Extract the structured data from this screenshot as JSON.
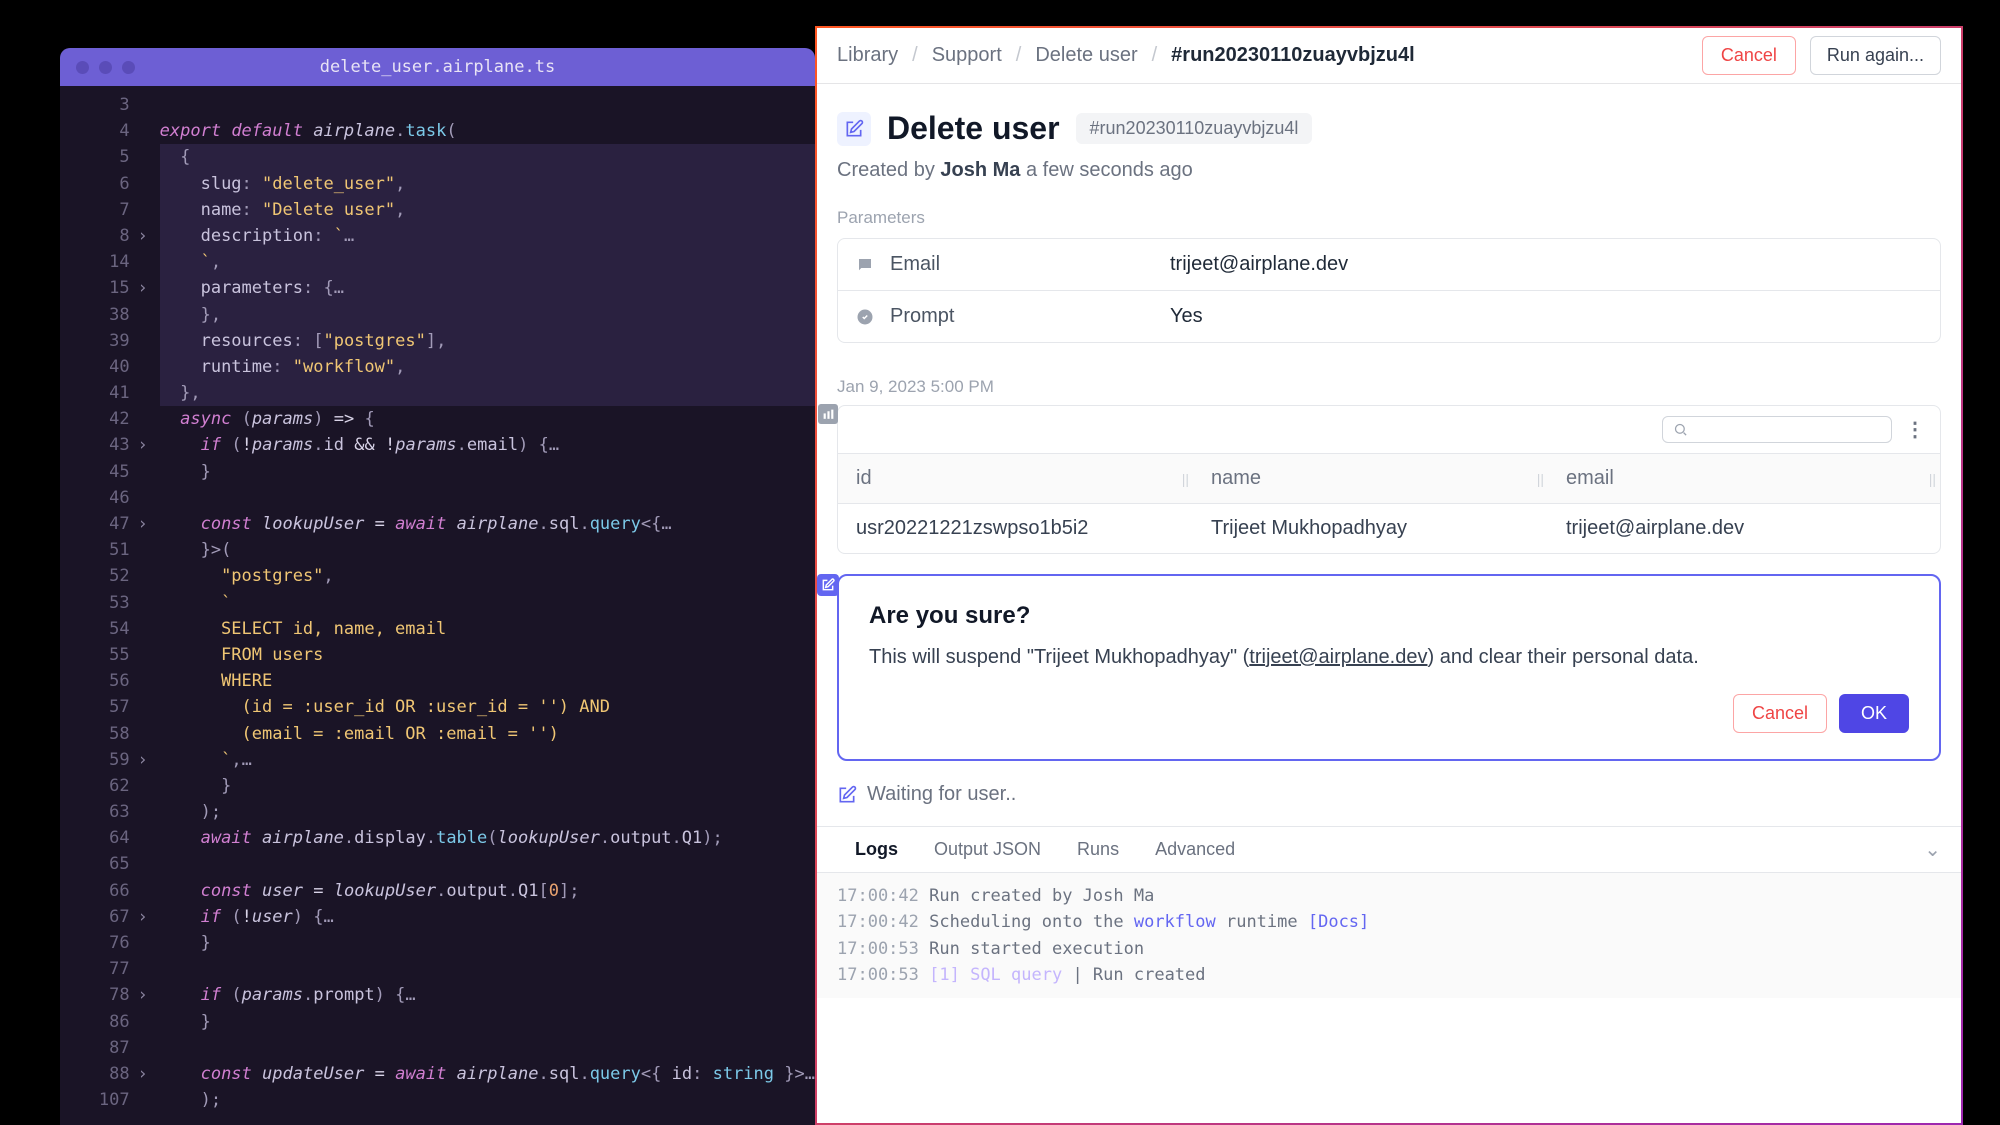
{
  "editor": {
    "title": "delete_user.airplane.ts",
    "lines": [
      {
        "n": 3,
        "fold": false,
        "code": ""
      },
      {
        "n": 4,
        "fold": false,
        "code": "<span class='c-kw'>export</span> <span class='c-kw'>default</span> <span class='c-var'>airplane</span><span class='c-punc'>.</span><span class='c-fn'>task</span><span class='c-punc'>(</span>"
      },
      {
        "n": 5,
        "fold": false,
        "hl": true,
        "code": "  <span class='c-punc'>{</span>"
      },
      {
        "n": 6,
        "fold": false,
        "hl": true,
        "code": "    <span class='c-prop'>slug</span><span class='c-punc'>:</span> <span class='c-str'>\"delete_user\"</span><span class='c-punc'>,</span>"
      },
      {
        "n": 7,
        "fold": false,
        "hl": true,
        "code": "    <span class='c-prop'>name</span><span class='c-punc'>:</span> <span class='c-str'>\"Delete user\"</span><span class='c-punc'>,</span>"
      },
      {
        "n": 8,
        "fold": true,
        "hl": true,
        "code": "    <span class='c-prop'>description</span><span class='c-punc'>:</span> <span class='c-str'>`</span><span class='c-punc'>…</span>"
      },
      {
        "n": 14,
        "fold": false,
        "hl": true,
        "code": "    <span class='c-str'>`</span><span class='c-punc'>,</span>"
      },
      {
        "n": 15,
        "fold": true,
        "hl": true,
        "code": "    <span class='c-prop'>parameters</span><span class='c-punc'>:</span> <span class='c-punc'>{</span><span class='c-punc'>…</span>"
      },
      {
        "n": 38,
        "fold": false,
        "hl": true,
        "code": "    <span class='c-punc'>},</span>"
      },
      {
        "n": 39,
        "fold": false,
        "hl": true,
        "code": "    <span class='c-prop'>resources</span><span class='c-punc'>:</span> <span class='c-punc'>[</span><span class='c-str'>\"postgres\"</span><span class='c-punc'>],</span>"
      },
      {
        "n": 40,
        "fold": false,
        "hl": true,
        "code": "    <span class='c-prop'>runtime</span><span class='c-punc'>:</span> <span class='c-str'>\"workflow\"</span><span class='c-punc'>,</span>"
      },
      {
        "n": 41,
        "fold": false,
        "hl": true,
        "code": "  <span class='c-punc'>},</span>"
      },
      {
        "n": 42,
        "fold": false,
        "code": "  <span class='c-kw'>async</span> <span class='c-punc'>(</span><span class='c-var'>params</span><span class='c-punc'>)</span> <span class='c-op'>=></span> <span class='c-punc'>{</span>"
      },
      {
        "n": 43,
        "fold": true,
        "code": "    <span class='c-kw'>if</span> <span class='c-punc'>(</span><span class='c-op'>!</span><span class='c-var'>params</span><span class='c-punc'>.</span><span class='c-prop'>id</span> <span class='c-op'>&&</span> <span class='c-op'>!</span><span class='c-var'>params</span><span class='c-punc'>.</span><span class='c-prop'>email</span><span class='c-punc'>)</span> <span class='c-punc'>{</span><span class='c-punc'>…</span>"
      },
      {
        "n": 45,
        "fold": false,
        "code": "    <span class='c-punc'>}</span>"
      },
      {
        "n": 46,
        "fold": false,
        "code": ""
      },
      {
        "n": 47,
        "fold": true,
        "code": "    <span class='c-kw'>const</span> <span class='c-var'>lookupUser</span> <span class='c-op'>=</span> <span class='c-kw'>await</span> <span class='c-var'>airplane</span><span class='c-punc'>.</span><span class='c-prop'>sql</span><span class='c-punc'>.</span><span class='c-fn'>query</span><span class='c-punc'>&lt;{</span><span class='c-punc'>…</span>"
      },
      {
        "n": 51,
        "fold": false,
        "code": "    <span class='c-punc'>}&gt;(</span>"
      },
      {
        "n": 52,
        "fold": false,
        "code": "      <span class='c-str'>\"postgres\"</span><span class='c-punc'>,</span>"
      },
      {
        "n": 53,
        "fold": false,
        "code": "      <span class='c-str'>`</span>"
      },
      {
        "n": 54,
        "fold": false,
        "code": "<span class='c-str'>      SELECT id, name, email</span>"
      },
      {
        "n": 55,
        "fold": false,
        "code": "<span class='c-str'>      FROM users</span>"
      },
      {
        "n": 56,
        "fold": false,
        "code": "<span class='c-str'>      WHERE</span>"
      },
      {
        "n": 57,
        "fold": false,
        "code": "<span class='c-str'>        (id = :user_id OR :user_id = '') AND</span>"
      },
      {
        "n": 58,
        "fold": false,
        "code": "<span class='c-str'>        (email = :email OR :email = '')</span>"
      },
      {
        "n": 59,
        "fold": true,
        "code": "      <span class='c-str'>`</span><span class='c-punc'>,</span><span class='c-punc'>…</span>"
      },
      {
        "n": 62,
        "fold": false,
        "code": "      <span class='c-punc'>}</span>"
      },
      {
        "n": 63,
        "fold": false,
        "code": "    <span class='c-punc'>);</span>"
      },
      {
        "n": 64,
        "fold": false,
        "code": "    <span class='c-kw'>await</span> <span class='c-var'>airplane</span><span class='c-punc'>.</span><span class='c-prop'>display</span><span class='c-punc'>.</span><span class='c-fn'>table</span><span class='c-punc'>(</span><span class='c-var'>lookupUser</span><span class='c-punc'>.</span><span class='c-prop'>output</span><span class='c-punc'>.</span><span class='c-prop'>Q1</span><span class='c-punc'>);</span>"
      },
      {
        "n": 65,
        "fold": false,
        "code": ""
      },
      {
        "n": 66,
        "fold": false,
        "code": "    <span class='c-kw'>const</span> <span class='c-var'>user</span> <span class='c-op'>=</span> <span class='c-var'>lookupUser</span><span class='c-punc'>.</span><span class='c-prop'>output</span><span class='c-punc'>.</span><span class='c-prop'>Q1</span><span class='c-punc'>[</span><span class='c-num'>0</span><span class='c-punc'>];</span>"
      },
      {
        "n": 67,
        "fold": true,
        "code": "    <span class='c-kw'>if</span> <span class='c-punc'>(</span><span class='c-op'>!</span><span class='c-var'>user</span><span class='c-punc'>)</span> <span class='c-punc'>{</span><span class='c-punc'>…</span>"
      },
      {
        "n": 76,
        "fold": false,
        "code": "    <span class='c-punc'>}</span>"
      },
      {
        "n": 77,
        "fold": false,
        "code": ""
      },
      {
        "n": 78,
        "fold": true,
        "code": "    <span class='c-kw'>if</span> <span class='c-punc'>(</span><span class='c-var'>params</span><span class='c-punc'>.</span><span class='c-prop'>prompt</span><span class='c-punc'>)</span> <span class='c-punc'>{</span><span class='c-punc'>…</span>"
      },
      {
        "n": 86,
        "fold": false,
        "code": "    <span class='c-punc'>}</span>"
      },
      {
        "n": 87,
        "fold": false,
        "code": ""
      },
      {
        "n": 88,
        "fold": true,
        "code": "    <span class='c-kw'>const</span> <span class='c-var'>updateUser</span> <span class='c-op'>=</span> <span class='c-kw'>await</span> <span class='c-var'>airplane</span><span class='c-punc'>.</span><span class='c-prop'>sql</span><span class='c-punc'>.</span><span class='c-fn'>query</span><span class='c-punc'>&lt;{</span> <span class='c-prop'>id</span><span class='c-punc'>:</span> <span class='c-type'>string</span> <span class='c-punc'>}&gt;</span><span class='c-punc'>…</span>"
      },
      {
        "n": 107,
        "fold": false,
        "code": "    <span class='c-punc'>);</span>"
      }
    ]
  },
  "breadcrumbs": [
    "Library",
    "Support",
    "Delete user"
  ],
  "run_id": "#run20230110zuayvbjzu4l",
  "header": {
    "cancel": "Cancel",
    "run_again": "Run again..."
  },
  "title": "Delete user",
  "created_by_prefix": "Created by ",
  "created_by_name": "Josh Ma",
  "created_by_suffix": " a few seconds ago",
  "params_label": "Parameters",
  "params": [
    {
      "icon": "chat",
      "key": "Email",
      "val": "trijeet@airplane.dev"
    },
    {
      "icon": "check",
      "key": "Prompt",
      "val": "Yes"
    }
  ],
  "timestamp": "Jan 9, 2023 5:00 PM",
  "table": {
    "headers": [
      "id",
      "name",
      "email"
    ],
    "rows": [
      {
        "id": "usr20221221zswpso1b5i2",
        "name": "Trijeet Mukhopadhyay",
        "email": "trijeet@airplane.dev"
      }
    ]
  },
  "prompt": {
    "title": "Are you sure?",
    "body_prefix": "This will suspend \"Trijeet Mukhopadhyay\" (",
    "body_email": "trijeet@airplane.dev",
    "body_suffix": ") and clear their personal data.",
    "cancel": "Cancel",
    "ok": "OK"
  },
  "waiting": "Waiting for user..",
  "tabs": [
    "Logs",
    "Output JSON",
    "Runs",
    "Advanced"
  ],
  "logs": [
    {
      "ts": "17:00:42",
      "txt": "Run created by Josh Ma"
    },
    {
      "ts": "17:00:42",
      "txt": "Scheduling onto the ",
      "link": "workflow",
      "txt2": " runtime ",
      "link2": "[Docs]"
    },
    {
      "ts": "17:00:53",
      "txt": "Run started execution"
    },
    {
      "ts": "17:00:53",
      "dim": "[1] SQL query",
      "sep": " | ",
      "txt": "Run created"
    }
  ]
}
